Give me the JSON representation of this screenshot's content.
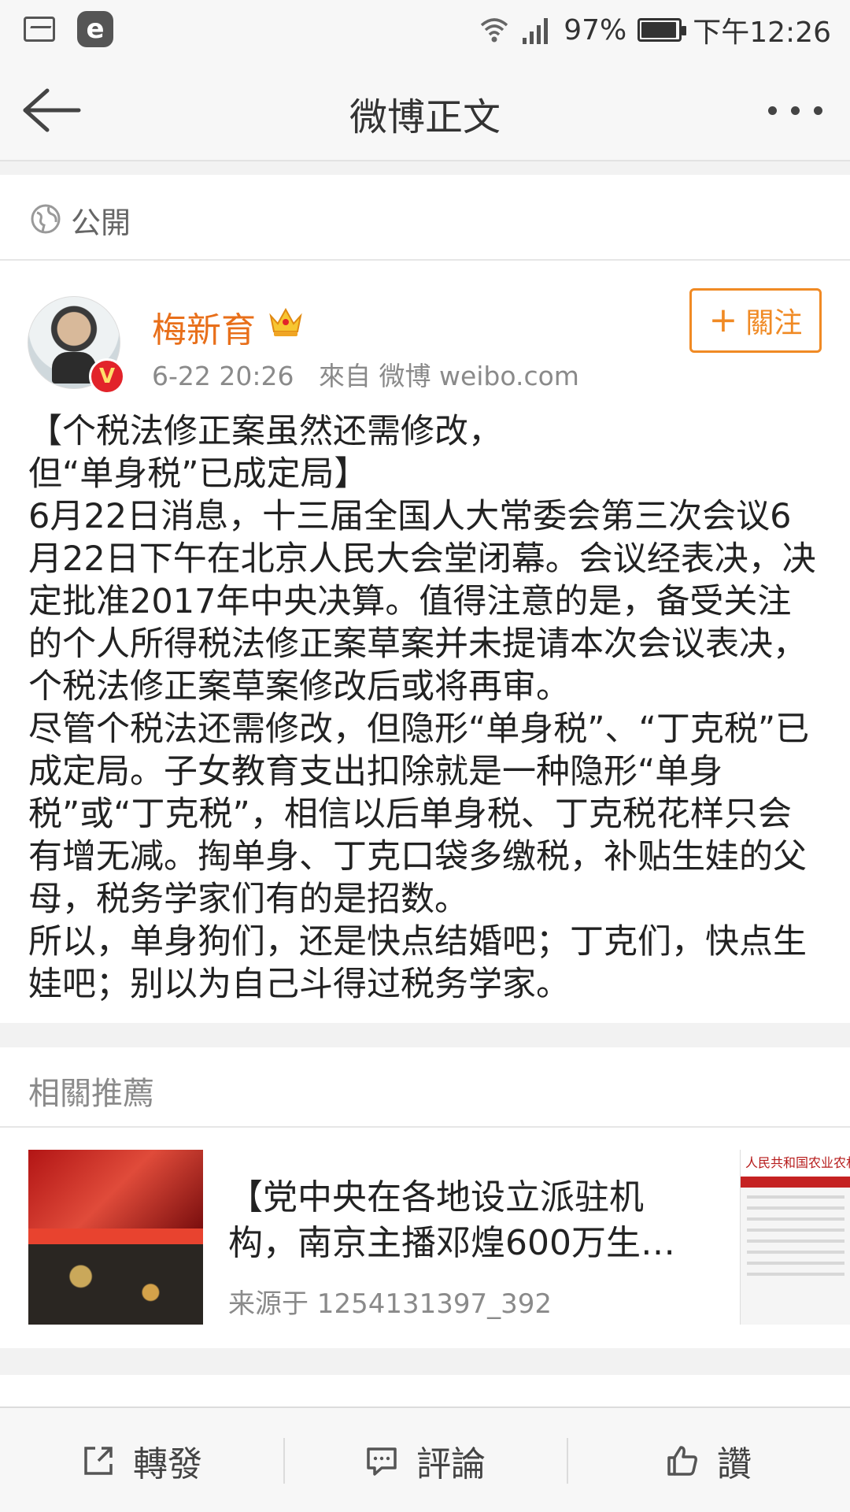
{
  "status_bar": {
    "battery": "97%",
    "time": "下午12:26",
    "icons": [
      "gallery-icon",
      "e-app-icon",
      "wifi-icon",
      "signal-icon",
      "battery-icon"
    ]
  },
  "header": {
    "title": "微博正文",
    "icons": [
      "back-arrow-icon",
      "more-icon"
    ]
  },
  "visibility": {
    "label": "公開",
    "icon": "globe-icon"
  },
  "post": {
    "author": "梅新育",
    "timestamp": "6-22 20:26",
    "source": "來自 微博 weibo.com",
    "follow_label": "關注",
    "paragraphs": [
      "【个税法修正案虽然还需修改，但“单身税”已成定局】",
      "6月22日消息，十三届全国人大常委会第三次会议6月22日下午在北京人民大会堂闭幕。会议经表决，决定批准2017年中央决算。值得注意的是，备受关注的个人所得税法修正案草案并未提请本次会议表决，个税法修正案草案修改后或将再审。",
      "尽管个税法还需修改，但隐形“单身税”、“丁克税”已成定局。子女教育支出扣除就是一种隐形“单身税”或“丁克税”，相信以后单身税、丁克税花样只会有增无减。掏单身、丁克口袋多缴税，补贴生娃的父母，税务学家们有的是招数。",
      "所以，单身狗们，还是快点结婚吧；丁克们，快点生娃吧；别以为自己斗得过税务学家。"
    ],
    "verified_badge": "V",
    "colors": {
      "username": "#e86f1a",
      "follow": "#f08a24",
      "badge": "#e2232a"
    }
  },
  "related": {
    "header": "相關推薦",
    "items": [
      {
        "title": "【党中央在各地设立派驻机构，南京主播邓煌600万生…",
        "source": "来源于 1254131397_392",
        "side_thumb_caption": "人民共和国农业农村部"
      }
    ]
  },
  "actions": [
    {
      "label": "轉發",
      "icon": "share-icon"
    },
    {
      "label": "評論",
      "icon": "comment-icon"
    },
    {
      "label": "讚",
      "icon": "like-icon"
    }
  ]
}
